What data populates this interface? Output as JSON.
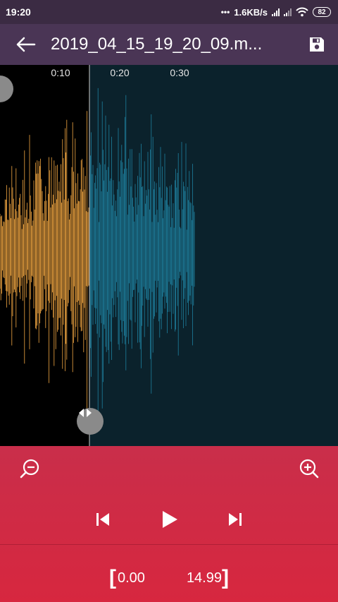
{
  "status_bar": {
    "time": "19:20",
    "dots": "•••",
    "network_speed": "1.6KB/s",
    "battery": "82"
  },
  "app_bar": {
    "title": "2019_04_15_19_20_09.m...",
    "back_icon": "arrow-left-icon",
    "save_icon": "floppy-disk-icon"
  },
  "timeline": {
    "labels": [
      "0:10",
      "0:20",
      "0:30"
    ]
  },
  "waveform": {
    "selected_color": "#f2a742",
    "unselected_color": "#1e7f9e",
    "background": "#0b222c",
    "selection_background": "#000000"
  },
  "controls": {
    "zoom_out_icon": "zoom-out-icon",
    "zoom_in_icon": "zoom-in-icon",
    "prev_icon": "skip-previous-icon",
    "play_icon": "play-icon",
    "next_icon": "skip-next-icon",
    "start_time": "0.00",
    "end_time": "14.99",
    "bracket_open": "[",
    "bracket_close": "]"
  }
}
